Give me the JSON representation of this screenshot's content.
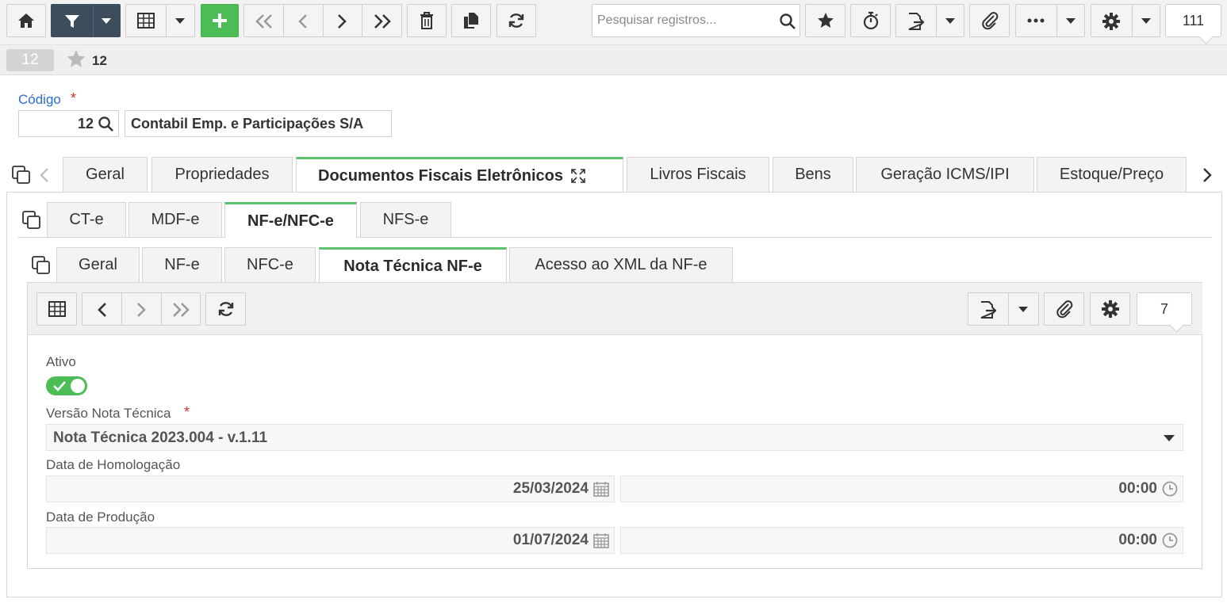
{
  "toolbar": {
    "search_placeholder": "Pesquisar registros...",
    "record_count": "111",
    "icons": [
      "home-icon",
      "filter-icon",
      "chevron-down-icon",
      "grid-icon",
      "plus-icon",
      "first-icon",
      "prev-icon",
      "next-icon",
      "last-icon",
      "trash-icon",
      "copy-icon",
      "refresh-icon",
      "search-icon",
      "star-icon",
      "stopwatch-icon",
      "export-icon",
      "paperclip-icon",
      "more-icon",
      "gear-icon"
    ]
  },
  "record": {
    "badge": "12",
    "title": "12"
  },
  "form": {
    "codigo_label": "Código",
    "required_mark": "*",
    "codigo_value": "12",
    "empresa_value": "Contabil Emp. e Participações S/A"
  },
  "tabs_main": [
    "Geral",
    "Propriedades",
    "Documentos Fiscais Eletrônicos",
    "Livros Fiscais",
    "Bens",
    "Geração ICMS/IPI",
    "Estoque/Preço"
  ],
  "tabs_doc": [
    "CT-e",
    "MDF-e",
    "NF-e/NFC-e",
    "NFS-e"
  ],
  "tabs_nfe": [
    "Geral",
    "NF-e",
    "NFC-e",
    "Nota Técnica NF-e",
    "Acesso ao XML da NF-e"
  ],
  "subtoolbar": {
    "record_count": "7"
  },
  "fields": {
    "ativo_label": "Ativo",
    "ativo_value": true,
    "versao_label": "Versão Nota Técnica",
    "versao_value": "Nota Técnica 2023.004 - v.1.11",
    "homolog_label": "Data de Homologação",
    "homolog_date": "25/03/2024",
    "homolog_time": "00:00",
    "producao_label": "Data de Produção",
    "producao_date": "01/07/2024",
    "producao_time": "00:00"
  },
  "colors": {
    "accent_green": "#4cbc55",
    "dark_button": "#3d4d5c",
    "link_blue": "#2a6fcf",
    "required_red": "#d0342c",
    "tab_active_border": "#5cc16b"
  }
}
